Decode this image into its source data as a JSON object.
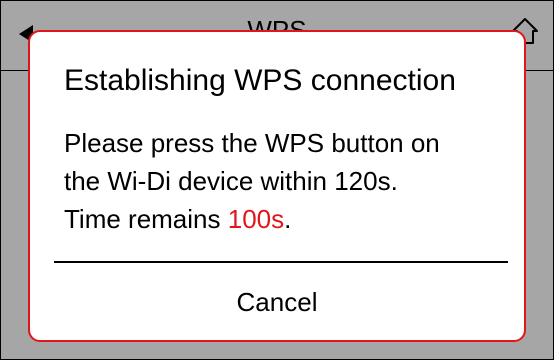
{
  "header": {
    "title": "WPS",
    "back_icon": "back-arrow-icon",
    "home_icon": "home-icon"
  },
  "dialog": {
    "title": "Establishing WPS connection",
    "message_line1": "Please press the WPS button on",
    "message_line2": "the Wi-Di device within 120s.",
    "message_line3_prefix": "Time remains ",
    "time_remaining": "100s",
    "message_line3_suffix": ".",
    "cancel_label": "Cancel"
  },
  "colors": {
    "accent": "#e0161c",
    "background": "#a6a6a6",
    "dialog_bg": "#ffffff"
  }
}
